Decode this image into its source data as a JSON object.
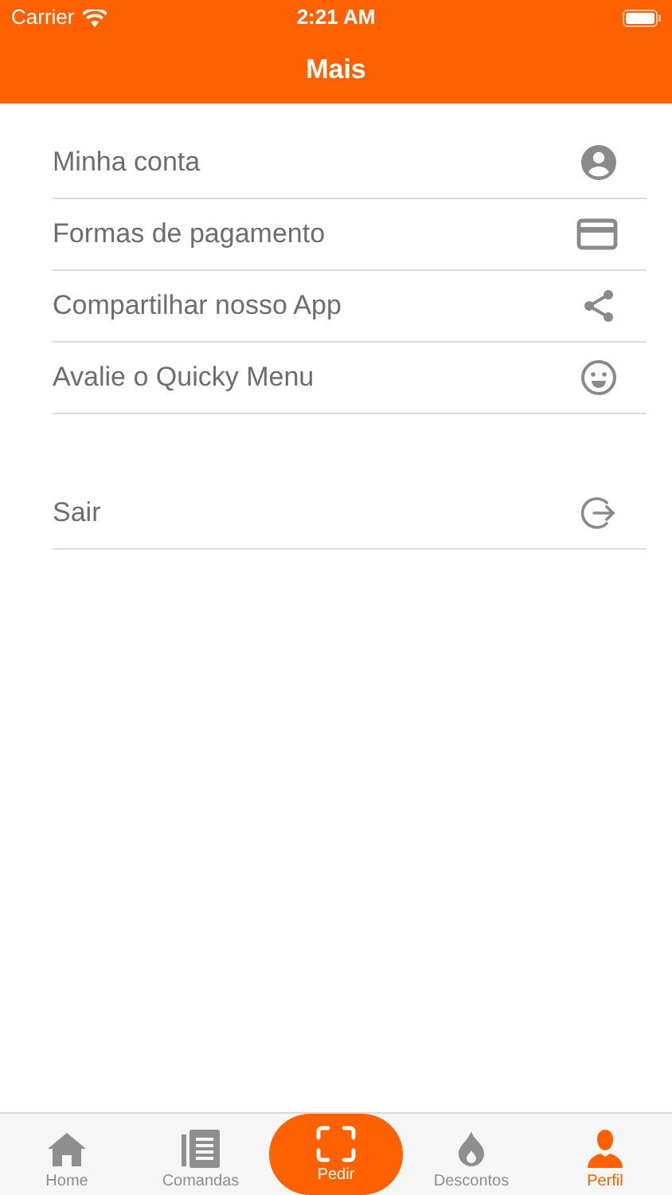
{
  "status_bar": {
    "carrier": "Carrier",
    "time": "2:21 AM"
  },
  "nav_bar": {
    "title": "Mais"
  },
  "menu_groups": [
    {
      "items": [
        {
          "label": "Minha conta",
          "kind": "account"
        },
        {
          "label": "Formas de pagamento",
          "kind": "card"
        },
        {
          "label": "Compartilhar nosso App",
          "kind": "share"
        },
        {
          "label": "Avalie o Quicky Menu",
          "kind": "smile"
        }
      ]
    },
    {
      "items": [
        {
          "label": "Sair",
          "kind": "logout"
        }
      ]
    }
  ],
  "tab_bar": [
    {
      "label": "Home",
      "kind": "home",
      "selected": false
    },
    {
      "label": "Comandas",
      "kind": "list",
      "selected": false
    },
    {
      "label": "Pedir",
      "kind": "scan",
      "selected": false
    },
    {
      "label": "Descontos",
      "kind": "flame",
      "selected": false
    },
    {
      "label": "Perfil",
      "kind": "person",
      "selected": true
    }
  ]
}
